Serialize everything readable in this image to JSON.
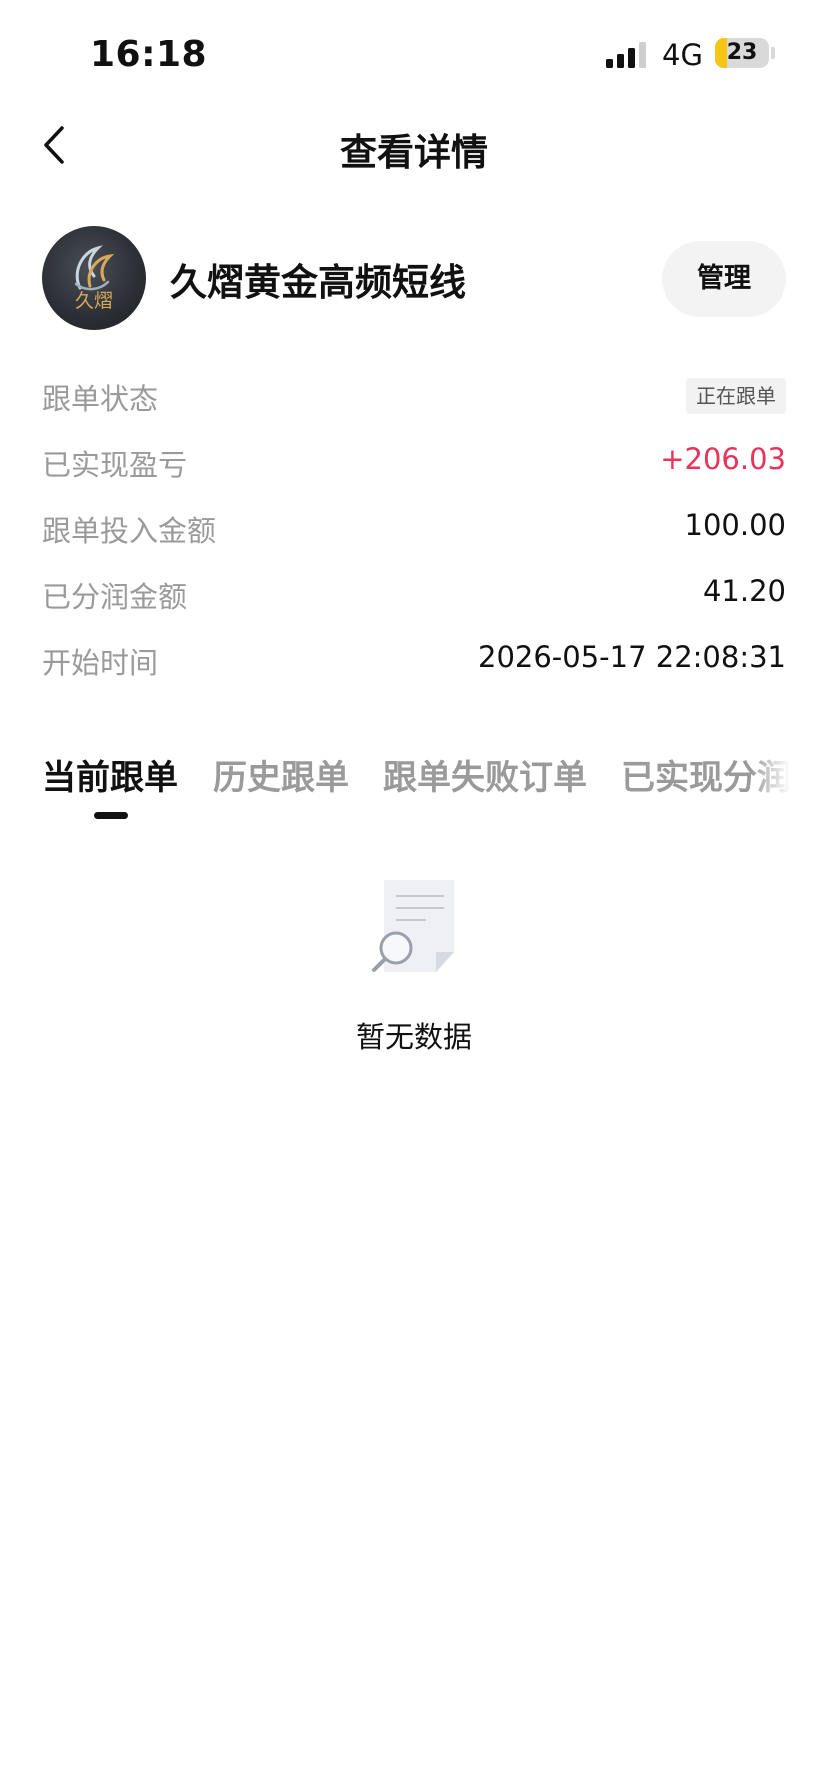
{
  "status_bar": {
    "time": "16:18",
    "network": "4G",
    "battery": "23",
    "battery_level": 0.23
  },
  "nav": {
    "title": "查看详情"
  },
  "strategy": {
    "name": "久熠黄金高频短线",
    "avatar_text": "久熠",
    "manage_label": "管理"
  },
  "info_rows": [
    {
      "label": "跟单状态",
      "value": "正在跟单",
      "kind": "badge"
    },
    {
      "label": "已实现盈亏",
      "value": "+206.03",
      "kind": "profit"
    },
    {
      "label": "跟单投入金额",
      "value": "100.00",
      "kind": "plain"
    },
    {
      "label": "已分润金额",
      "value": "41.20",
      "kind": "plain"
    },
    {
      "label": "开始时间",
      "value": "2026-05-17 22:08:31",
      "kind": "plain"
    }
  ],
  "tabs": [
    {
      "label": "当前跟单",
      "active": true
    },
    {
      "label": "历史跟单",
      "active": false
    },
    {
      "label": "跟单失败订单",
      "active": false
    },
    {
      "label": "已实现分润",
      "active": false
    }
  ],
  "empty_state": {
    "text": "暂无数据"
  },
  "colors": {
    "profit": "#e8335a",
    "label_gray": "#9a9a9a",
    "battery_fill": "#f5c518"
  }
}
